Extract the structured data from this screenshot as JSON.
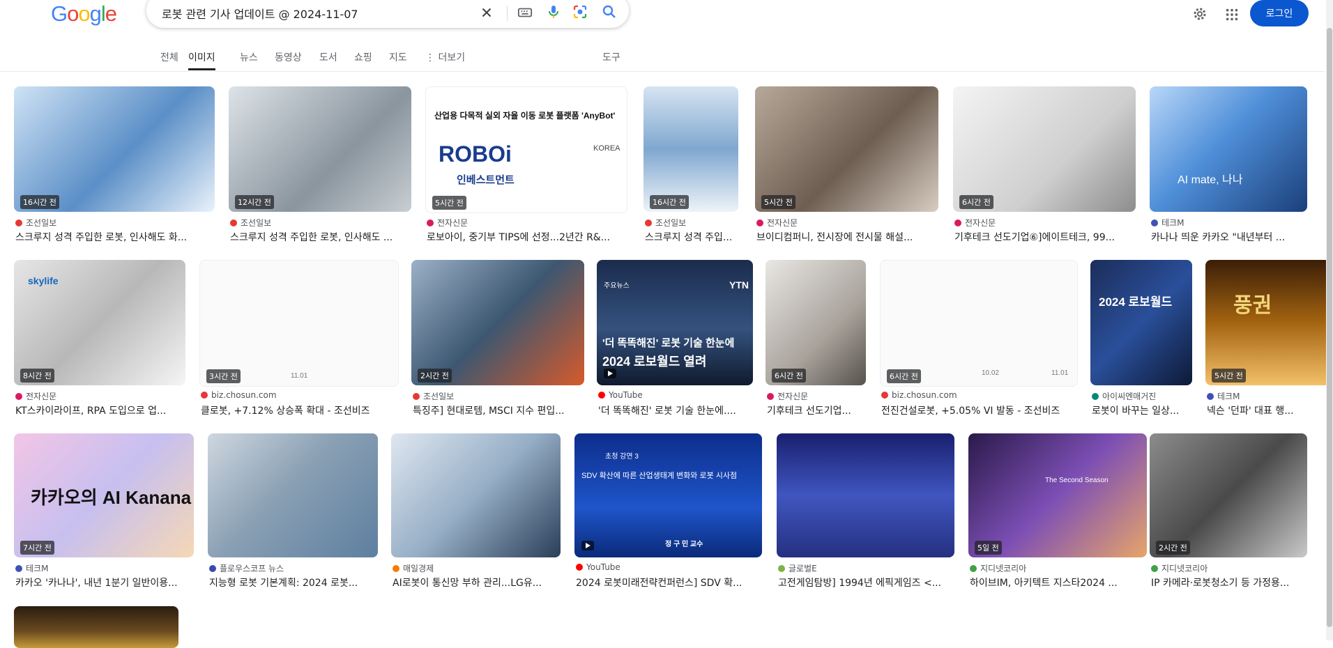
{
  "search": {
    "query": "로봇 관련 기사 업데이트 @ 2024-11-07",
    "icons": [
      "close-icon",
      "keyboard-icon",
      "mic-icon",
      "lens-icon",
      "search-icon"
    ]
  },
  "header": {
    "logo": "Google",
    "login": "로그인",
    "icons": [
      "gear-icon",
      "apps-icon"
    ]
  },
  "tabs": [
    "전체",
    "이미지",
    "뉴스",
    "동영상",
    "도서",
    "쇼핑",
    "지도",
    "⋮ 더보기"
  ],
  "tools": "도구",
  "active_tab": "이미지",
  "results": [
    {
      "time": "16시간 전",
      "source": "조선일보",
      "caption": "스크루지 성격 주입한 로봇, 인사해도 화..."
    },
    {
      "time": "12시간 전",
      "source": "조선일보",
      "caption": "스크루지 성격 주입한 로봇, 인사해도 ..."
    },
    {
      "time": "5시간 전",
      "source": "전자신문",
      "caption": "로보아이, 중기부 TIPS에 선정...2년간 R&...",
      "img_title": "산업용 다목적 실외 자율 이동 로봇 플랫폼 'AnyBot'",
      "img_logo1": "ROBOi",
      "img_logo2": "인베스트먼트",
      "img_logo3": "KOREA"
    },
    {
      "time": "16시간 전",
      "source": "조선일보",
      "caption": "스크루지 성격 주입..."
    },
    {
      "time": "5시간 전",
      "source": "전자신문",
      "caption": "브이디컴퍼니, 전시장에 전시물 해설..."
    },
    {
      "time": "6시간 전",
      "source": "전자신문",
      "caption": "기후테크 선도기업⑥]에이트테크, 99..."
    },
    {
      "time": "",
      "source": "테크M",
      "caption": "카나나 띄운 카카오 \"내년부터 ...",
      "img_text": "AI mate, 나나"
    },
    {
      "time": "8시간 전",
      "source": "전자신문",
      "caption": "KT스카이라이프, RPA 도입으로 업...",
      "img_text": "skylife"
    },
    {
      "time": "3시간 전",
      "source": "biz.chosun.com",
      "caption": "클로봇, +7.12% 상승폭 확대 - 조선비즈",
      "img_axis": "11.01"
    },
    {
      "time": "2시간 전",
      "source": "조선일보",
      "caption": "특징주] 현대로템, MSCI 지수 편입..."
    },
    {
      "time": "",
      "source": "YouTube",
      "caption": "'더 똑똑해진' 로봇 기술 한눈에....",
      "img_text1": "'더 똑똑해진' 로봇 기술 한눈에",
      "img_text2": "2024 로보월드 열려",
      "img_brand": "YTN",
      "img_tag": "주요뉴스"
    },
    {
      "time": "6시간 전",
      "source": "전자신문",
      "caption": "기후테크 선도기업..."
    },
    {
      "time": "6시간 전",
      "source": "biz.chosun.com",
      "caption": "전진건설로봇, +5.05% VI 발동 - 조선비즈",
      "img_axis1": "10.02",
      "img_axis2": "11.01"
    },
    {
      "time": "",
      "source": "아이씨엔매거진",
      "caption": "로봇이 바꾸는 일상...",
      "img_text": "2024 로보월드"
    },
    {
      "time": "5시간 전",
      "source": "테크M",
      "caption": "넥슨 '던파' 대표 행...",
      "img_text": "풍권"
    },
    {
      "time": "7시간 전",
      "source": "테크M",
      "caption": "카카오 '카나나', 내년 1분기 일반이용...",
      "img_text": "카카오의 AI Kanana"
    },
    {
      "time": "",
      "source": "플로우스코프 뉴스",
      "caption": "지능형 로봇 기본계획: 2024 로봇..."
    },
    {
      "time": "",
      "source": "매일경제",
      "caption": "AI로봇이 통신망 부하 관리...LG유..."
    },
    {
      "time": "",
      "source": "YouTube",
      "caption": "2024 로봇미래전략컨퍼런스] SDV 확...",
      "img_text1": "SDV 확산에 따른 산업생태계 변화와 로봇 시사점",
      "img_text2": "정 구 민 교수",
      "img_tag": "초청 강연 3"
    },
    {
      "time": "",
      "source": "글로벌E",
      "caption": "고전게임탐방] 1994년 에픽게임즈 <..."
    },
    {
      "time": "5일 전",
      "source": "지디넷코리아",
      "caption": "하이브IM, 아키텍트 지스타2024 ...",
      "img_text": "The Second Season"
    },
    {
      "time": "2시간 전",
      "source": "지디넷코리아",
      "caption": "IP 카메라·로봇청소기 등 가정용..."
    }
  ],
  "colors": {
    "accent": "#0b57d0",
    "blue": "#4285f4",
    "red": "#ea4335",
    "yellow": "#fbbc05",
    "green": "#34a853"
  }
}
